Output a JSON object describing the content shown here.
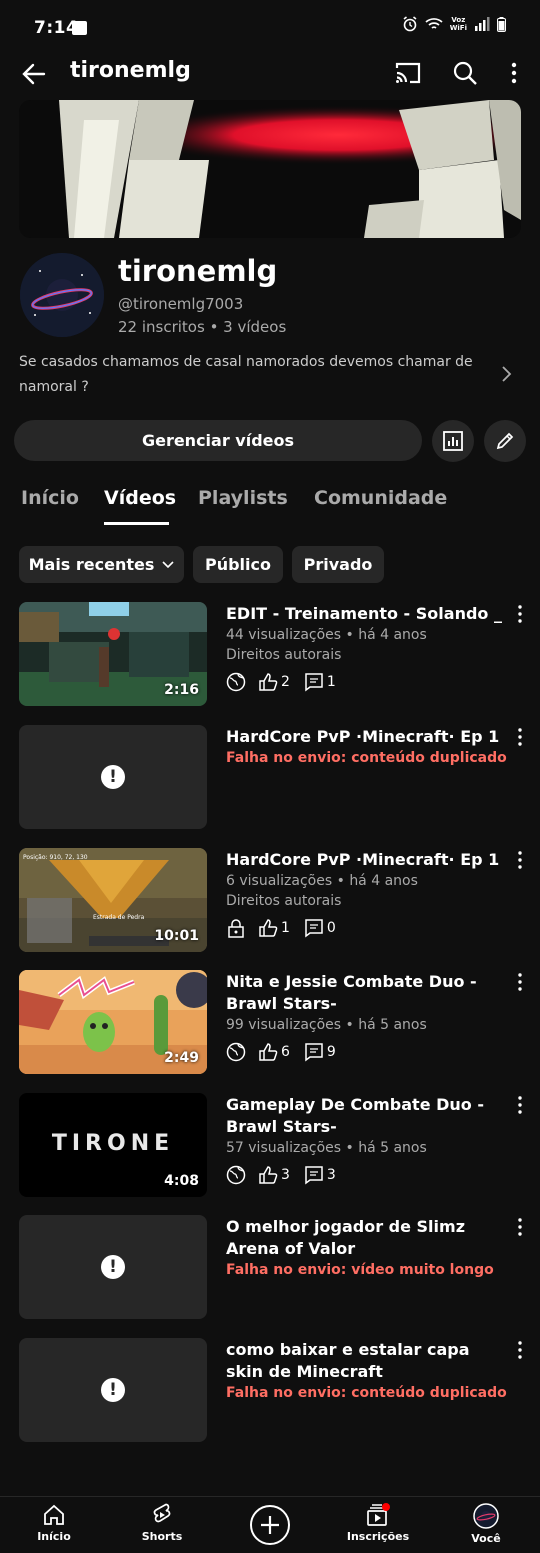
{
  "status_bar": {
    "time": "7:14",
    "network_label": "Voz\nWiFi"
  },
  "app_bar": {
    "title": "tironemlg",
    "icons": [
      "back-arrow-icon",
      "cast-icon",
      "search-icon",
      "more-vert-icon"
    ]
  },
  "channel": {
    "name": "tironemlg",
    "handle": "@tironemlg7003",
    "stats": "22 inscritos • 3 vídeos",
    "description": "Se casados chamamos de casal namorados devemos chamar de namoral ?"
  },
  "actions": {
    "manage_label": "Gerenciar vídeos",
    "analytics_icon": "analytics-icon",
    "edit_icon": "pencil-icon"
  },
  "tabs": [
    {
      "label": "Início",
      "active": false
    },
    {
      "label": "Vídeos",
      "active": true
    },
    {
      "label": "Playlists",
      "active": false
    },
    {
      "label": "Comunidade",
      "active": false
    }
  ],
  "filters": {
    "sort_label": "Mais recentes",
    "public_label": "Público",
    "private_label": "Privado"
  },
  "videos": [
    {
      "title": "EDIT - Treinamento - Solando _",
      "views": "44 visualizações • há 4 anos",
      "rights": "Direitos autorais",
      "duration": "2:16",
      "likes": "2",
      "comments": "1",
      "visibility": "globe-icon"
    },
    {
      "title": "HardCore PvP ·Minecraft· Ep 1",
      "error": "Falha no envio: conteúdo duplicado"
    },
    {
      "title": "HardCore PvP ·Minecraft· Ep 1",
      "views": "6 visualizações • há 4 anos",
      "rights": "Direitos autorais",
      "duration": "10:01",
      "likes": "1",
      "comments": "0",
      "visibility": "lock-icon",
      "thumb_text_1": "Posição: 910, 72, 130",
      "thumb_text_2": "Estrada de Pedra"
    },
    {
      "title": "Nita e Jessie Combate Duo -Brawl Stars-",
      "views": "99 visualizações • há 5 anos",
      "duration": "2:49",
      "likes": "6",
      "comments": "9",
      "visibility": "globe-icon"
    },
    {
      "title": "Gameplay De Combate Duo -Brawl Stars-",
      "views": "57 visualizações • há 5 anos",
      "duration": "4:08",
      "likes": "3",
      "comments": "3",
      "visibility": "globe-icon",
      "thumb_text": "TIRONE"
    },
    {
      "title": "O melhor jogador de Slimz Arena of Valor",
      "error": "Falha no envio: vídeo muito longo"
    },
    {
      "title": "como baixar e estalar capa skin de Minecraft",
      "error": "Falha no envio: conteúdo duplicado"
    }
  ],
  "bottom_nav": {
    "home": "Início",
    "shorts": "Shorts",
    "subscriptions": "Inscrições",
    "you": "Você"
  },
  "colors": {
    "background": "#0f0f0f",
    "surface": "#272727",
    "error": "#ff6e63",
    "secondary_text": "#aaaaaa",
    "notification_dot": "#ff0000"
  }
}
